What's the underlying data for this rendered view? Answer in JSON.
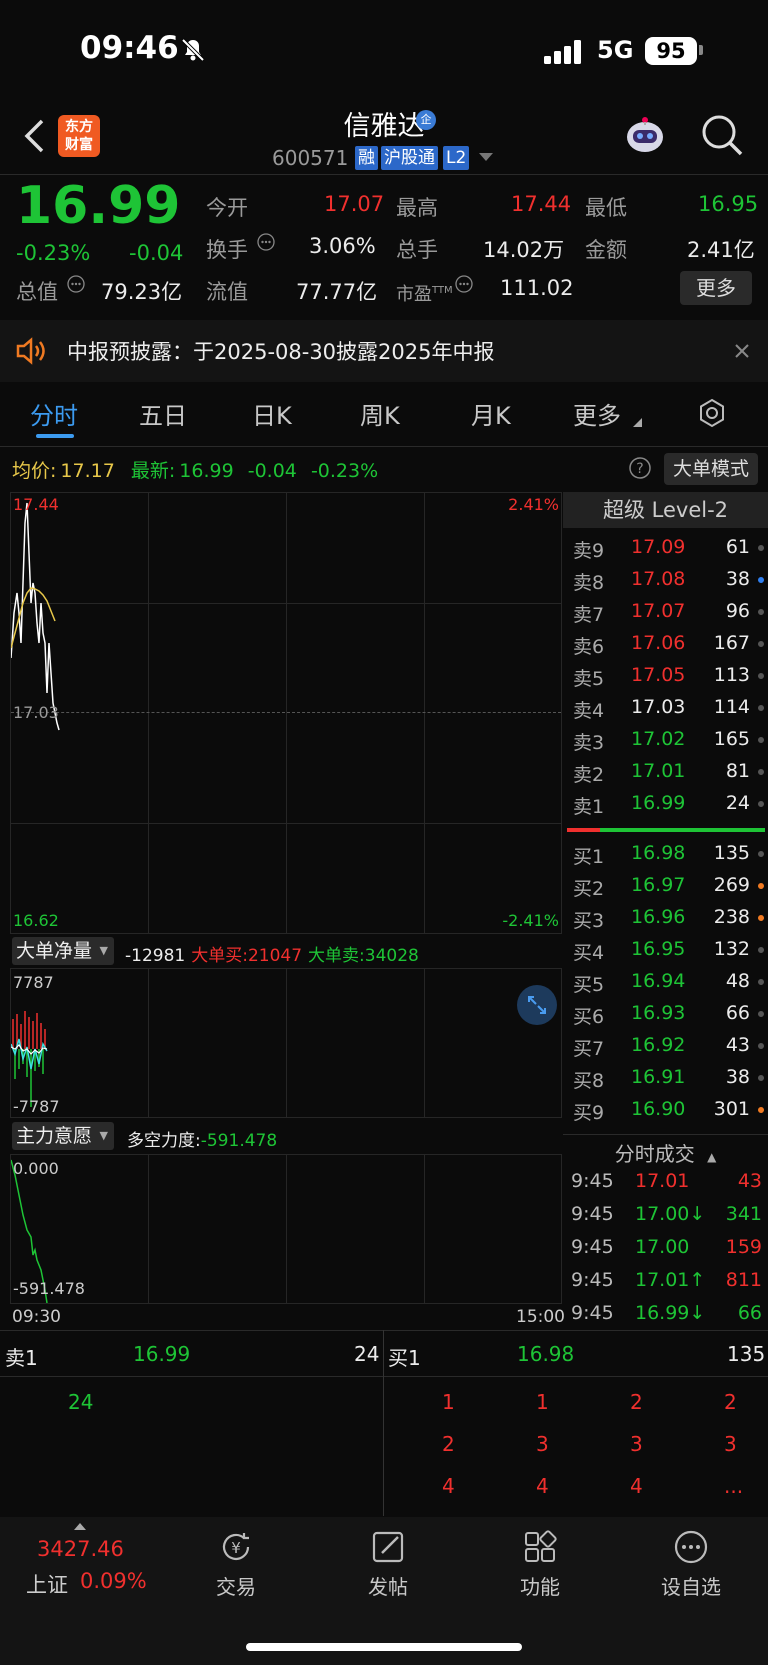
{
  "status": {
    "time": "09:46",
    "network": "5G",
    "battery": "95"
  },
  "header": {
    "app_logo": "东方\n财富",
    "stock_name": "信雅达",
    "ent_badge": "企",
    "code": "600571",
    "tags": [
      "融",
      "沪股通",
      "L2"
    ]
  },
  "quote": {
    "price": "16.99",
    "pct": "-0.23%",
    "chg": "-0.04",
    "fields": [
      {
        "label": "今开",
        "value": "17.07"
      },
      {
        "label": "最高",
        "value": "17.44"
      },
      {
        "label": "最低",
        "value": "16.95"
      },
      {
        "label": "换手",
        "value": "3.06%"
      },
      {
        "label": "总手",
        "value": "14.02万"
      },
      {
        "label": "金额",
        "value": "2.41亿"
      },
      {
        "label": "总值",
        "value": "79.23亿"
      },
      {
        "label": "流值",
        "value": "77.77亿"
      },
      {
        "label": "市盈",
        "sup": "TTM",
        "value": "111.02"
      }
    ],
    "more": "更多"
  },
  "notice": {
    "text": "中报预披露：于2025-08-30披露2025年中报"
  },
  "tabs": [
    "分时",
    "五日",
    "日K",
    "周K",
    "月K",
    "更多"
  ],
  "summary": {
    "avg_label": "均价:",
    "avg": "17.17",
    "latest_label": "最新:",
    "latest": "16.99",
    "chg": "-0.04",
    "pct": "-0.23%",
    "mode": "大单模式"
  },
  "chart": {
    "y_top": "17.44",
    "y_bottom": "16.62",
    "pct_top": "2.41%",
    "pct_bottom": "-2.41%",
    "prev_close": "17.03",
    "time_start": "09:30",
    "time_end": "15:00"
  },
  "panel2": {
    "title": "大单净量",
    "net": "-12981",
    "buy_label": "大单买:",
    "buy": "21047",
    "sell_label": "大单卖:",
    "sell": "34028",
    "top": "7787",
    "bottom": "-7787"
  },
  "panel3": {
    "title": "主力意愿",
    "label": "多空力度:",
    "value": "-591.478",
    "top": "0.000",
    "bottom": "-591.478"
  },
  "orderbook": {
    "title": "超级 Level-2",
    "asks": [
      {
        "l": "卖9",
        "p": "17.09",
        "v": "61",
        "c": "red"
      },
      {
        "l": "卖8",
        "p": "17.08",
        "v": "38",
        "c": "red"
      },
      {
        "l": "卖7",
        "p": "17.07",
        "v": "96",
        "c": "red"
      },
      {
        "l": "卖6",
        "p": "17.06",
        "v": "167",
        "c": "red"
      },
      {
        "l": "卖5",
        "p": "17.05",
        "v": "113",
        "c": "red"
      },
      {
        "l": "卖4",
        "p": "17.03",
        "v": "114",
        "c": "white"
      },
      {
        "l": "卖3",
        "p": "17.02",
        "v": "165",
        "c": "green"
      },
      {
        "l": "卖2",
        "p": "17.01",
        "v": "81",
        "c": "green"
      },
      {
        "l": "卖1",
        "p": "16.99",
        "v": "24",
        "c": "green"
      }
    ],
    "bids": [
      {
        "l": "买1",
        "p": "16.98",
        "v": "135",
        "c": "green"
      },
      {
        "l": "买2",
        "p": "16.97",
        "v": "269",
        "c": "green"
      },
      {
        "l": "买3",
        "p": "16.96",
        "v": "238",
        "c": "green"
      },
      {
        "l": "买4",
        "p": "16.95",
        "v": "132",
        "c": "green"
      },
      {
        "l": "买5",
        "p": "16.94",
        "v": "48",
        "c": "green"
      },
      {
        "l": "买6",
        "p": "16.93",
        "v": "66",
        "c": "green"
      },
      {
        "l": "买7",
        "p": "16.92",
        "v": "43",
        "c": "green"
      },
      {
        "l": "买8",
        "p": "16.91",
        "v": "38",
        "c": "green"
      },
      {
        "l": "买9",
        "p": "16.90",
        "v": "301",
        "c": "green"
      }
    ],
    "trades_title": "分时成交",
    "trades": [
      {
        "t": "9:45",
        "p": "17.01",
        "v": "43",
        "pc": "red",
        "vc": "red",
        "arr": ""
      },
      {
        "t": "9:45",
        "p": "17.00",
        "v": "341",
        "pc": "green",
        "vc": "green",
        "arr": "↓"
      },
      {
        "t": "9:45",
        "p": "17.00",
        "v": "159",
        "pc": "green",
        "vc": "red",
        "arr": ""
      },
      {
        "t": "9:45",
        "p": "17.01",
        "v": "811",
        "pc": "green",
        "vc": "red",
        "arr": "↑"
      },
      {
        "t": "9:45",
        "p": "16.99",
        "v": "66",
        "pc": "green",
        "vc": "green",
        "arr": "↓"
      }
    ]
  },
  "queue": {
    "sell_label": "卖1",
    "sell_price": "16.99",
    "sell_vol": "24",
    "sell_items": [
      "24"
    ],
    "buy_label": "买1",
    "buy_price": "16.98",
    "buy_vol": "135",
    "buy_items": [
      "1",
      "1",
      "2",
      "2",
      "2",
      "3",
      "3",
      "3",
      "4",
      "4",
      "4",
      "..."
    ]
  },
  "bottom": {
    "index_value": "3427.46",
    "index_name": "上证",
    "index_pct": "0.09%",
    "items": [
      "交易",
      "发帖",
      "功能",
      "设自选"
    ]
  }
}
